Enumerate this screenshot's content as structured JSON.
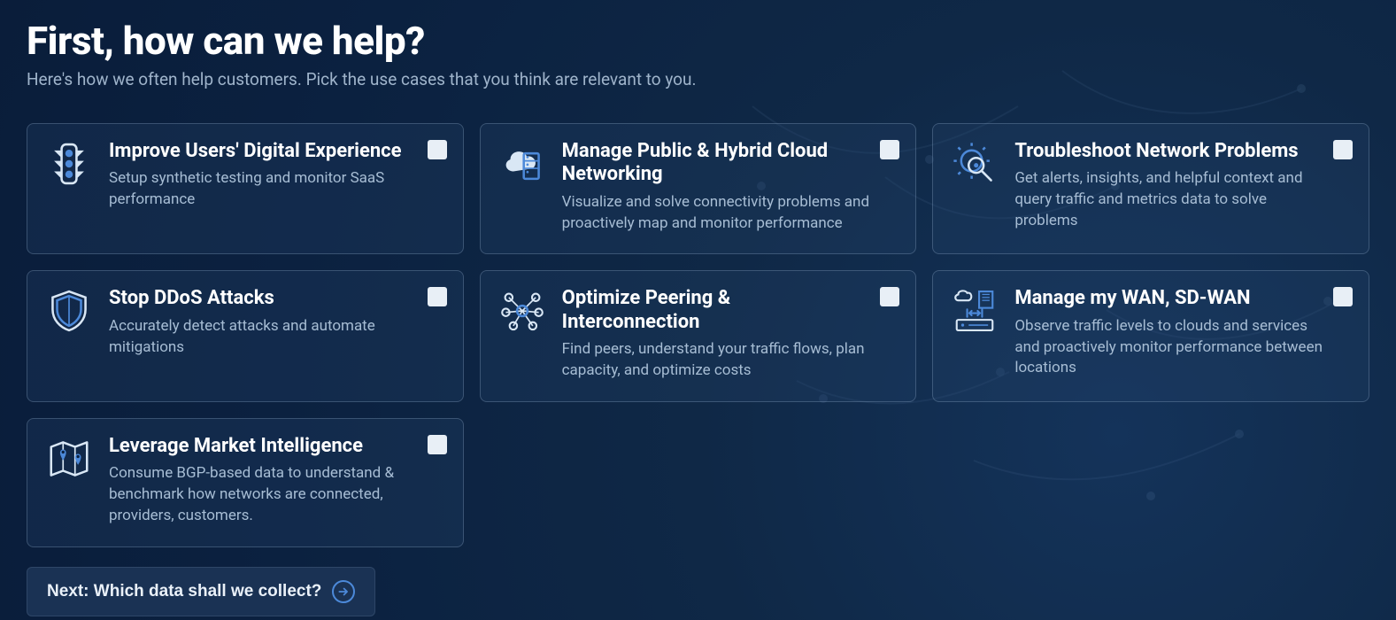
{
  "header": {
    "title": "First, how can we help?",
    "subtitle": "Here's how we often help customers. Pick the use cases that you think are relevant to you."
  },
  "cards": [
    {
      "id": "improve-digital-experience",
      "icon": "traffic-light-icon",
      "title": "Improve Users' Digital Experience",
      "desc": "Setup synthetic testing and monitor SaaS performance"
    },
    {
      "id": "manage-cloud-networking",
      "icon": "cloud-server-icon",
      "title": "Manage Public & Hybrid Cloud Networking",
      "desc": "Visualize and solve connectivity problems and proactively map and monitor performance"
    },
    {
      "id": "troubleshoot-network",
      "icon": "gear-magnify-icon",
      "title": "Troubleshoot Network Problems",
      "desc": "Get alerts, insights, and helpful context and query traffic and metrics data to solve problems"
    },
    {
      "id": "stop-ddos",
      "icon": "shield-icon",
      "title": "Stop DDoS Attacks",
      "desc": "Accurately detect attacks and automate mitigations"
    },
    {
      "id": "optimize-peering",
      "icon": "network-nodes-icon",
      "title": "Optimize Peering & Interconnection",
      "desc": "Find peers, understand your traffic flows, plan capacity, and optimize costs"
    },
    {
      "id": "manage-wan",
      "icon": "wan-devices-icon",
      "title": "Manage my WAN, SD-WAN",
      "desc": "Observe traffic levels to clouds and services and proactively monitor performance between locations"
    },
    {
      "id": "market-intelligence",
      "icon": "map-pins-icon",
      "title": "Leverage Market Intelligence",
      "desc": "Consume BGP-based data to understand & benchmark how networks are connected, providers, customers."
    }
  ],
  "next_button": {
    "label": "Next: Which data shall we collect?"
  }
}
